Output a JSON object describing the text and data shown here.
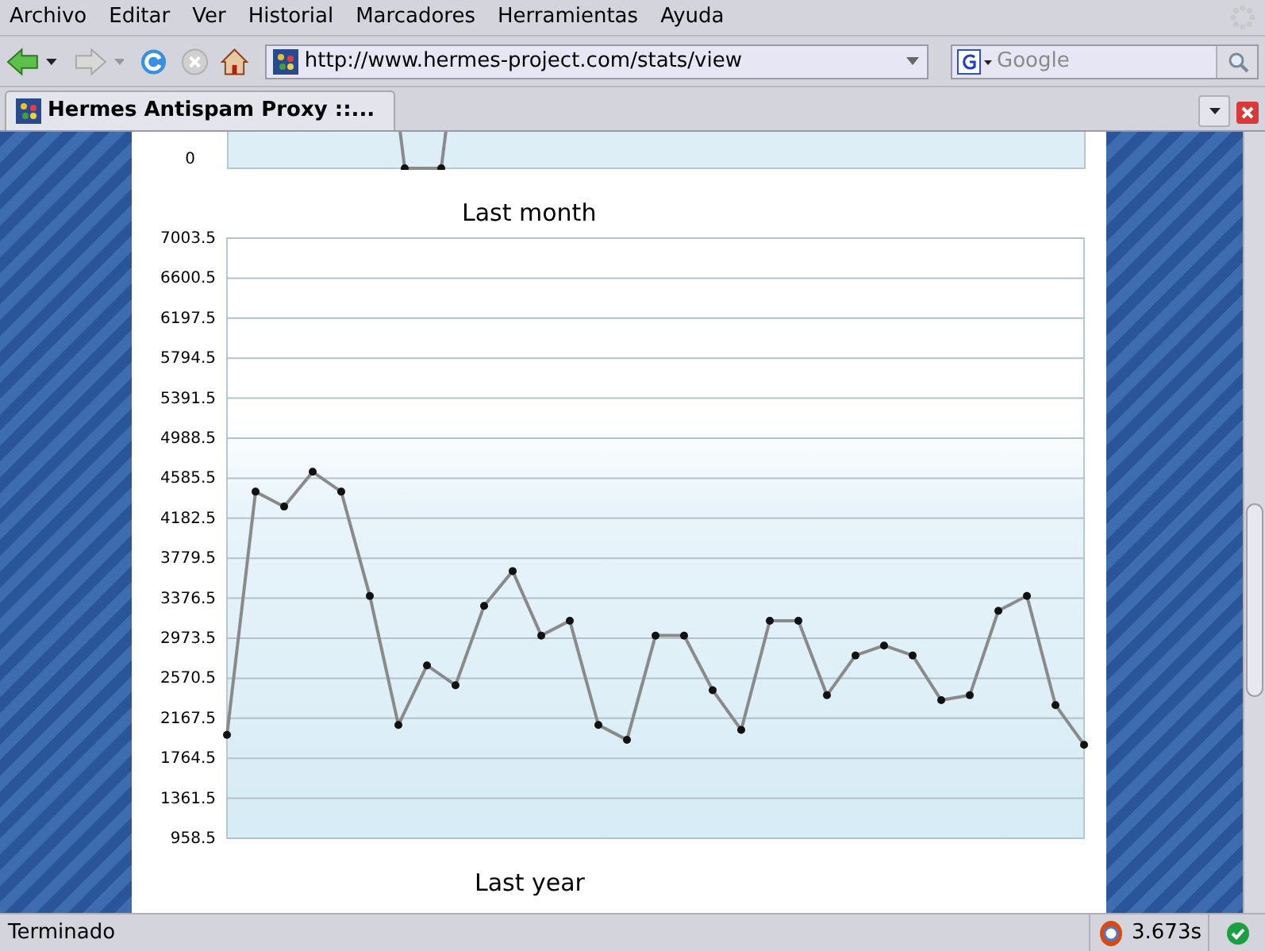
{
  "menu": [
    {
      "label": "Archivo"
    },
    {
      "label": "Editar"
    },
    {
      "label": "Ver"
    },
    {
      "label": "Historial"
    },
    {
      "label": "Marcadores"
    },
    {
      "label": "Herramientas"
    },
    {
      "label": "Ayuda"
    }
  ],
  "toolbar": {
    "url": "http://www.hermes-project.com/stats/view",
    "search": {
      "placeholder": "Google"
    }
  },
  "tabs": [
    {
      "label": "Hermes Antispam Proxy ::...",
      "selected": true
    }
  ],
  "page": {
    "top_chart": {
      "axis_label": "0"
    },
    "sections": [
      {
        "title": "Last month",
        "chart_data": {
          "type": "line",
          "ylim": [
            958.5,
            7003.5
          ],
          "yticks": [
            958.5,
            1361.5,
            1764.5,
            2167.5,
            2570.5,
            2973.5,
            3376.5,
            3779.5,
            4182.5,
            4585.5,
            4988.5,
            5391.5,
            5794.5,
            6197.5,
            6600.5,
            7003.5
          ],
          "grid": true,
          "series": [
            {
              "color": "#8a8a8a",
              "marker": true,
              "values": [
                2000,
                4450,
                4300,
                4650,
                4450,
                3400,
                2100,
                2700,
                2500,
                3300,
                3650,
                3000,
                3150,
                2100,
                1950,
                3000,
                3000,
                2450,
                2050,
                3150,
                3150,
                2400,
                2800,
                2900,
                2800,
                2350,
                2400,
                3250,
                3400,
                2300,
                1900
              ]
            }
          ]
        }
      },
      {
        "title": "Last year"
      }
    ]
  },
  "status_bar": {
    "text": "Terminado",
    "timing": "3.673s"
  }
}
